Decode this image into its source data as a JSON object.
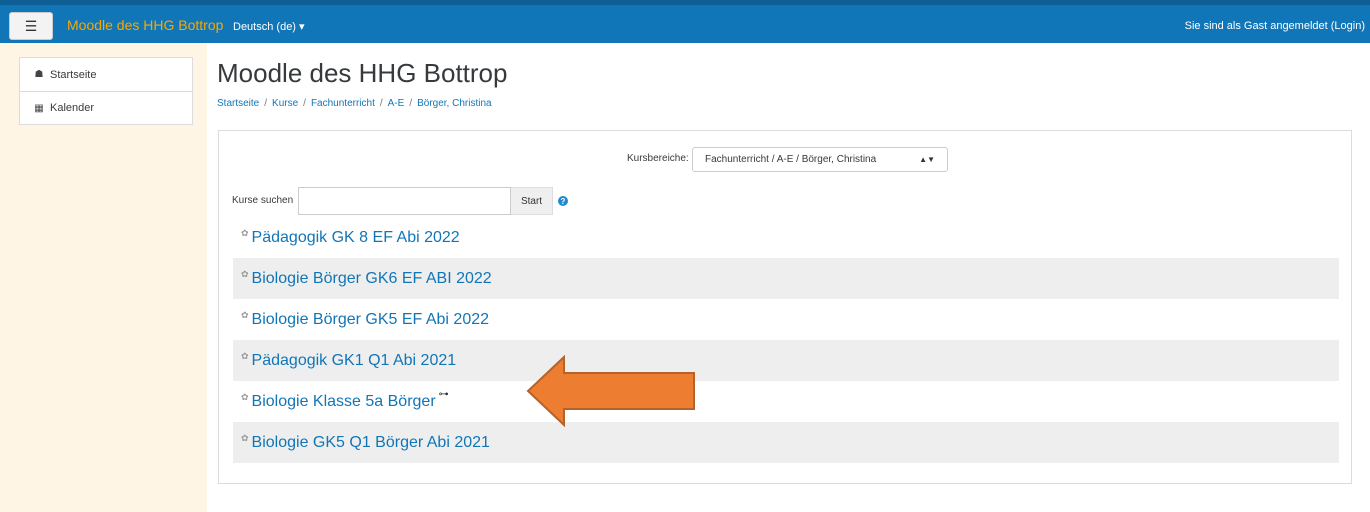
{
  "navbar": {
    "toggle_icon": "hamburger-icon",
    "brand": "Moodle des HHG Bottrop",
    "language": "Deutsch (de) ▾",
    "login_text": "Sie sind als Gast angemeldet (Login)"
  },
  "sidebar": {
    "items": [
      {
        "label": "Startseite",
        "icon": "home-icon"
      },
      {
        "label": "Kalender",
        "icon": "calendar-icon"
      }
    ]
  },
  "main": {
    "title": "Moodle des HHG Bottrop",
    "breadcrumb": [
      "Startseite",
      "Kurse",
      "Fachunterricht",
      "A-E",
      "Börger, Christina"
    ],
    "category_label": "Kursbereiche:",
    "category_value": "Fachunterricht / A-E / Börger, Christina",
    "search_label": "Kurse suchen",
    "search_value": "",
    "search_button": "Start",
    "courses": [
      {
        "name": "Pädagogik GK 8 EF Abi 2022",
        "key": false
      },
      {
        "name": "Biologie Börger GK6 EF ABI 2022",
        "key": false
      },
      {
        "name": "Biologie Börger GK5 EF Abi 2022",
        "key": false
      },
      {
        "name": "Pädagogik GK1 Q1 Abi 2021",
        "key": false
      },
      {
        "name": "Biologie Klasse 5a Börger",
        "key": true
      },
      {
        "name": "Biologie GK5 Q1 Börger Abi 2021",
        "key": false
      }
    ]
  },
  "colors": {
    "navbar": "#1176b7",
    "brand": "#f7a800",
    "sidebar_bg": "#fff5e4",
    "link": "#1176b7",
    "arrow_fill": "#ed7d31",
    "arrow_stroke": "#b4632a"
  }
}
